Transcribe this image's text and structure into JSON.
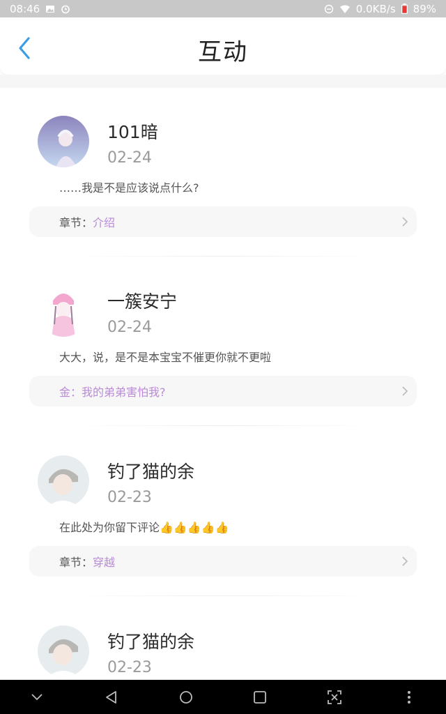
{
  "status_bar": {
    "time": "08:46",
    "network_speed": "0.0KB/s",
    "battery": "89%"
  },
  "header": {
    "title": "互动"
  },
  "interactions": [
    {
      "username": "101暗",
      "date": "02-24",
      "comment": "……我是不是应该说点什么?",
      "link_prefix": "章节：",
      "link_text": "介绍"
    },
    {
      "username": "一簇安宁",
      "date": "02-24",
      "comment": "大大，说，是不是本宝宝不催更你就不更啦",
      "link_prefix": "",
      "link_text": "金：我的弟弟害怕我?"
    },
    {
      "username": "钓了猫的余",
      "date": "02-23",
      "comment": "在此处为你留下评论👍👍👍👍👍",
      "link_prefix": "章节：",
      "link_text": "穿越"
    },
    {
      "username": "钓了猫的余",
      "date": "02-23"
    }
  ],
  "colors": {
    "accent": "#3a9ee4",
    "link": "#b98ad6",
    "status_bar": "#c8c8c8"
  }
}
